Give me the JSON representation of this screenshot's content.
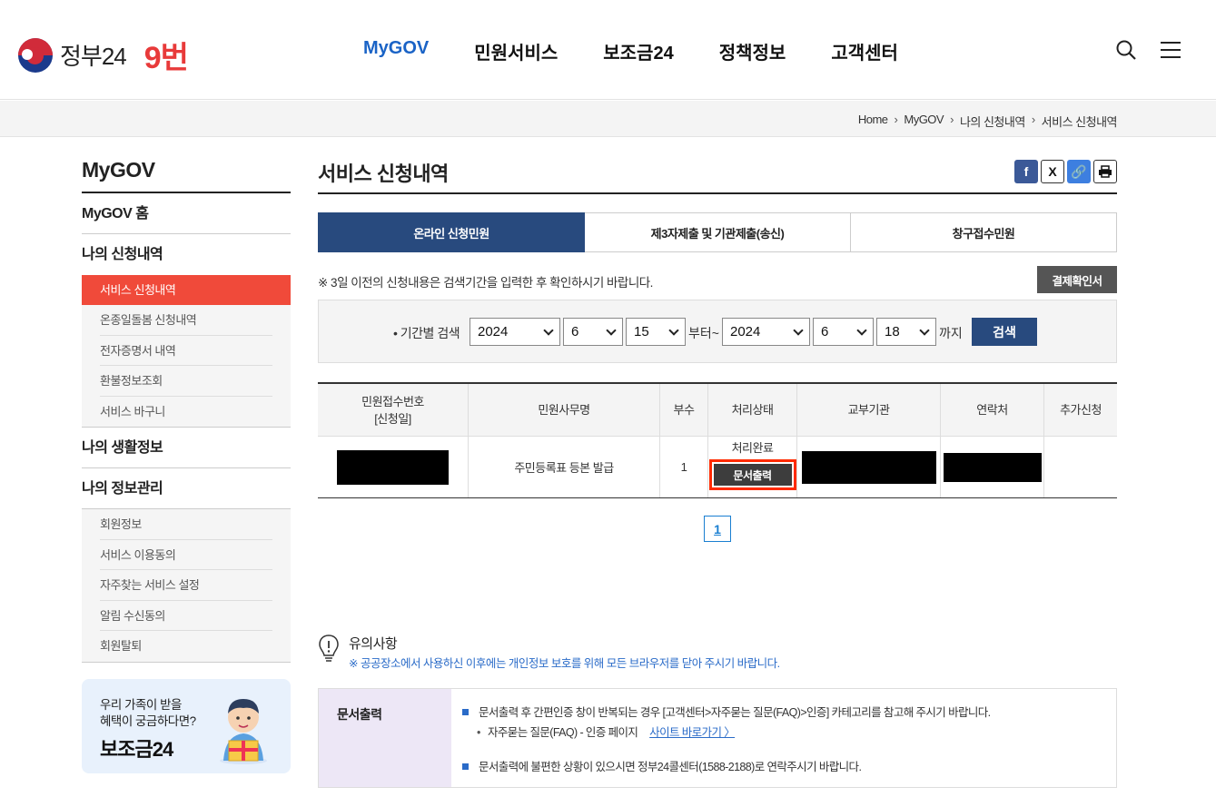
{
  "header": {
    "logo_text": "정부24",
    "logo_number": "9번",
    "nav": [
      "MyGOV",
      "민원서비스",
      "보조금24",
      "정책정보",
      "고객센터"
    ]
  },
  "breadcrumb": [
    "Home",
    "MyGOV",
    "나의 신청내역",
    "서비스 신청내역"
  ],
  "sidebar": {
    "title": "MyGOV",
    "home": "MyGOV 홈",
    "section1": "나의 신청내역",
    "section1_items": [
      "서비스 신청내역",
      "온종일돌봄 신청내역",
      "전자증명서 내역",
      "환불정보조회",
      "서비스 바구니"
    ],
    "section2": "나의 생활정보",
    "section3": "나의 정보관리",
    "section3_items": [
      "회원정보",
      "서비스 이용동의",
      "자주찾는 서비스 설정",
      "알림 수신동의",
      "회원탈퇴"
    ],
    "banner": {
      "line1": "우리 가족이 받을",
      "line2": "혜택이 궁금하다면?",
      "line3": "보조금24"
    }
  },
  "main": {
    "title": "서비스 신청내역",
    "tabs": [
      "온라인 신청민원",
      "제3자제출 및 기관제출(송신)",
      "창구접수민원"
    ],
    "notice": "※ 3일 이전의 신청내용은 검색기간을 입력한 후 확인하시기 바랍니다.",
    "receipt_button": "결제확인서",
    "search": {
      "label": "• 기간별 검색",
      "from_year": "2024",
      "from_month": "6",
      "from_day": "15",
      "from_text": "부터~",
      "to_year": "2024",
      "to_month": "6",
      "to_day": "18",
      "to_text": "까지",
      "button": "검색"
    },
    "table": {
      "headers": [
        "민원접수번호",
        "[신청일]",
        "민원사무명",
        "부수",
        "처리상태",
        "교부기관",
        "연락처",
        "추가신청"
      ],
      "row": {
        "service_name": "주민등록표 등본 발급",
        "copies": "1",
        "status": "처리완료",
        "print_button": "문서출력"
      }
    },
    "page": "1",
    "caution": {
      "title": "유의사항",
      "text": "※ 공공장소에서 사용하신 이후에는 개인정보 보호를 위해 모든 브라우저를 닫아 주시기 바랍니다."
    },
    "info": {
      "heading": "문서출력",
      "line1": "문서출력 후 간편인증 창이 반복되는 경우 [고객센터>자주묻는 질문(FAQ)>인증] 카테고리를 참고해 주시기 바랍니다.",
      "sub_line": "자주묻는 질문(FAQ) - 인증 페이지",
      "sub_link": "사이트 바로가기 〉",
      "line2": "문서출력에 불편한 상황이 있으시면 정부24콜센터(1588-2188)로 연락주시기 바랍니다."
    }
  }
}
